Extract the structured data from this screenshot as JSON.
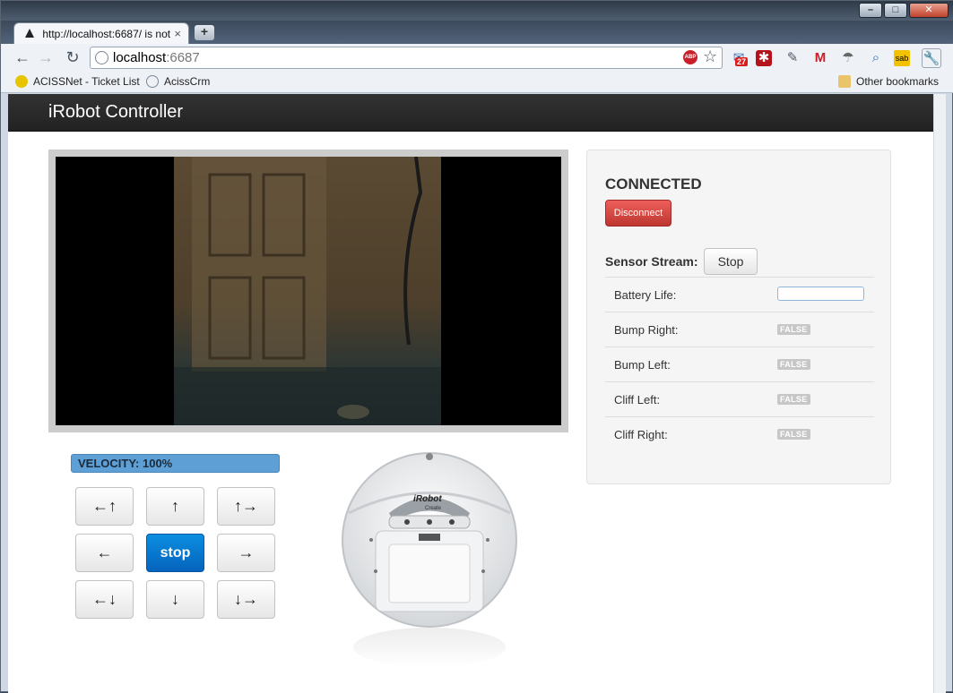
{
  "browser": {
    "tab_title": "http://localhost:6687/ is not",
    "tab_close": "×",
    "new_tab": "+",
    "url_host": "localhost",
    "url_port": ":6687",
    "abp_label": "ABP",
    "mail_badge": "27",
    "bookmarks": [
      {
        "label": "ACISSNet - Ticket List"
      },
      {
        "label": "AcissCrm"
      }
    ],
    "other_bookmarks": "Other bookmarks"
  },
  "app": {
    "brand": "iRobot Controller",
    "velocity_label": "VELOCITY: 100%",
    "velocity_percent": 100,
    "dpad": {
      "up_left": "←↑",
      "up": "↑",
      "up_right": "↑→",
      "left": "←",
      "stop": "stop",
      "right": "→",
      "down_left": "←↓",
      "down": "↓",
      "down_right": "↓→"
    },
    "robot_brand": "iRobot",
    "robot_model": "Create"
  },
  "panel": {
    "status": "CONNECTED",
    "disconnect_label": "Disconnect",
    "sensor_stream_label": "Sensor Stream:",
    "sensor_stream_button": "Stop",
    "battery_life_label": "Battery Life:",
    "battery_life_value": "",
    "sensors": [
      {
        "label": "Bump Right:",
        "value": "FALSE"
      },
      {
        "label": "Bump Left:",
        "value": "FALSE"
      },
      {
        "label": "Cliff Left:",
        "value": "FALSE"
      },
      {
        "label": "Cliff Right:",
        "value": "FALSE"
      }
    ]
  },
  "colors": {
    "navbar": "#222222",
    "velocity_bar": "#5ea0d6",
    "stop_button": "#0a7ad0",
    "disconnect_button": "#d9534f",
    "false_label": "#c7c7c7"
  }
}
